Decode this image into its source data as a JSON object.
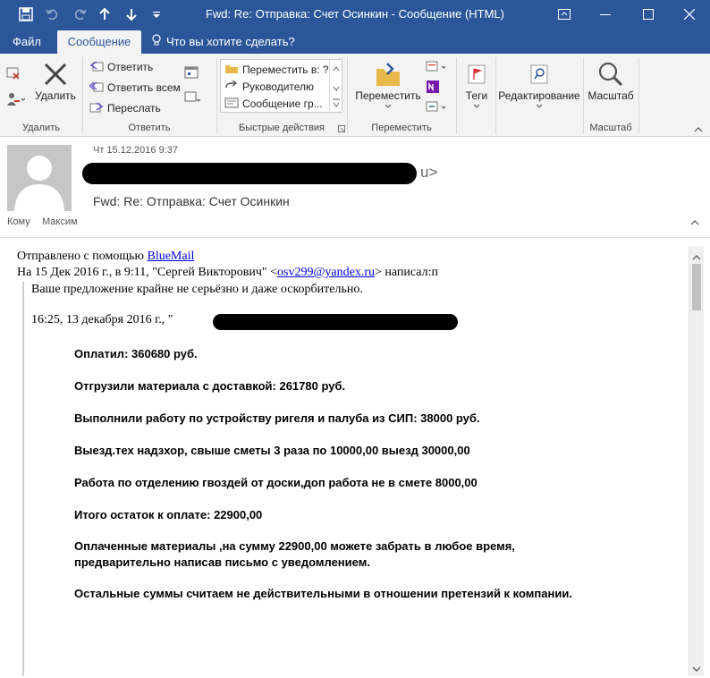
{
  "window": {
    "title": "Fwd: Re: Отправка: Счет Осинкин  -  Сообщение (HTML)"
  },
  "tabs": {
    "file": "Файл",
    "message": "Сообщение",
    "tell_me": "Что вы хотите сделать?"
  },
  "ribbon": {
    "delete_group": {
      "delete_label": "Удалить",
      "group_label": "Удалить"
    },
    "respond_group": {
      "reply": "Ответить",
      "reply_all": "Ответить всем",
      "forward": "Переслать",
      "group_label": "Ответить"
    },
    "quick_steps": {
      "items": [
        "Переместить в: ?",
        "Руководителю",
        "Сообщение гр..."
      ],
      "group_label": "Быстрые действия"
    },
    "move_group": {
      "move_label": "Переместить",
      "group_label": "Переместить"
    },
    "tags_label": "Теги",
    "editing_label": "Редактирование",
    "zoom_group": {
      "zoom_label": "Масштаб",
      "group_label": "Масштаб"
    }
  },
  "header": {
    "date": "Чт 15.12.2016 9:37",
    "sender_suffix": "u>",
    "subject": "Fwd: Re: Отправка: Счет Осинкин",
    "to_label": "Кому",
    "to_value": "Максим"
  },
  "body": {
    "sent_with_prefix": "Отправлено с помощью ",
    "sent_with_link": "BlueMail",
    "reply_header_prefix": "На 15 Дек 2016 г., в 9:11, \"Сергей Викторович\" <",
    "reply_header_email": "osv299@yandex.ru",
    "reply_header_suffix": "> написал:п",
    "quote_line": "Ваше предложение крайне не серьёзно и даже оскорбительно.",
    "quoted_header_prefix": "16:25, 13 декабря 2016 г., \"",
    "bold_lines": [
      "Оплатил: 360680 руб.",
      "Отгрузили материала с доставкой: 261780 руб.",
      "Выполнили работу по устройству ригеля и палуба из СИП: 38000 руб.",
      "Выезд.тех надзхор, свыше сметы 3 раза по 10000,00 выезд 30000,00",
      "Работа по отделению гвоздей от доски,доп работа не в смете 8000,00",
      "Итого остаток к оплате: 22900,00",
      "Оплаченные материалы ,на сумму 22900,00 можете забрать в любое время,",
      "предварительно написав письмо с уведомлением.",
      "Остальные суммы считаем не действительными в отношении претензий к компании."
    ]
  }
}
